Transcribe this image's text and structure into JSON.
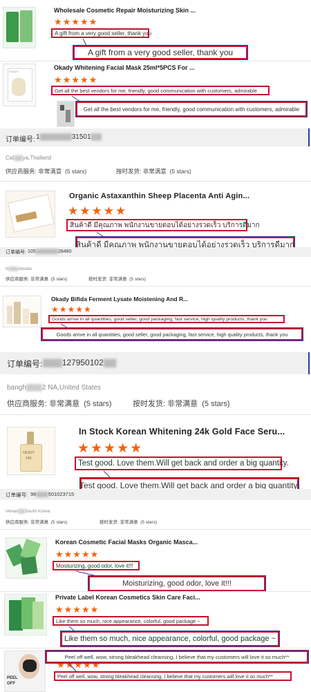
{
  "reviews": [
    {
      "title": "Wholesale Cosmetic Repair Moisturizing Skin ...",
      "stars": "★★★★★",
      "review": "A gift from a very good seller, thank you",
      "bubble": "A gift from a very good seller, thank you"
    },
    {
      "title": "Okady Whitening Facial Mask 25ml*5PCS For ...",
      "stars": "★★★★★",
      "review": "Get all the best vendors for me, friendly, good communication with customers, admirable",
      "bubble": "Get all the best vendors for me, friendly, good communication with customers, admirable"
    },
    {
      "title": "Organic Astaxanthin Sheep Placenta Anti Agin...",
      "stars": "★★★★★",
      "review": "สินค้าดี มีคุณภาพ พนักงานขายตอบได้อย่างรวดเร็ว บริการดีมาก",
      "bubble": "สินค้าดี มีคุณภาพ พนักงานขายตอบได้อย่างรวดเร็ว บริการดีมาก"
    },
    {
      "title": "Okady Bifida Ferment Lysate Moistening And R...",
      "stars": "★★★★★",
      "review": "Goods arrive in all quantities, good seller, good packaging, fast service, high quality products, thank you",
      "bubble": "Goods arrive in all quantities, good seller, good packaging, fast service, high quality products, thank you"
    },
    {
      "title": "In Stock Korean Whitening 24k Gold Face Seru...",
      "stars": "★★★★★",
      "review": "Test good. Love them.Will get back and order a big quantity.",
      "bubble": "Test good. Love them.Will get back and order a big quantity."
    },
    {
      "title": "Korean Cosmetic Facial Masks Organic Masca...",
      "stars": "★★★★★",
      "review": "Moisturizing, good odor, love it!!!",
      "bubble": "Moisturizing, good odor, love it!!!"
    },
    {
      "title": "Private Label Korean Cosmetics Skin Care Faci...",
      "stars": "★★★★★",
      "review": "Like them so much, nice appearance, colorful, good package ~",
      "bubble": "Like them so much, nice appearance, colorful, good package ~"
    },
    {
      "stars": "★★★★★",
      "review": "Peel off well, wow, strong bleakhead cleansing, I believe that my customers will love it so much**",
      "bubble": "Peel off well, wow, strong bleakhead cleansing, I believe that my customers will love it so much**"
    }
  ],
  "orders": [
    {
      "label": "订单编号:",
      "number": "1",
      "number_mid": "31501",
      "location_a": "Cat",
      "location_b": "ya,Thailand",
      "supplier_label": "供应商服务:",
      "supplier_value": "非常满意",
      "supplier_stars": "(5 stars)",
      "delivery_label": "按时发货:",
      "delivery_value": "非常满意",
      "delivery_stars": "(5 stars)"
    },
    {
      "label": "订单编号:",
      "number": "105",
      "number_tail": "28480",
      "location_a": "N",
      "location_b": "mbodia",
      "supplier_label": "供应商服务:",
      "supplier_value": "非常满意",
      "supplier_stars": "(5 stars)",
      "delivery_label": "按时发货:",
      "delivery_value": "非常满意",
      "delivery_stars": "(5 stars)"
    },
    {
      "label": "订单编号:",
      "number": "127950102",
      "location_a": "bangh",
      "location_b": "2 NA,United States",
      "supplier_label": "供应商服务:",
      "supplier_value": "非常满意",
      "supplier_stars": "(5 stars)",
      "delivery_label": "按时发货:",
      "delivery_value": "非常满意",
      "delivery_stars": "(5 stars)"
    },
    {
      "label": "订单编号:",
      "number": "98",
      "number_tail": "501023715",
      "location_a": "Venas",
      "location_b": "South Korea",
      "supplier_label": "供应商服务:",
      "supplier_value": "非常满意",
      "supplier_stars": "(5 stars)",
      "delivery_label": "按时发货:",
      "delivery_value": "非常满意",
      "delivery_stars": "(5 stars)"
    }
  ],
  "thumb_text": {
    "brand_okady": "OKADY",
    "serum_sub": "24K",
    "peel_a": "PEEL",
    "peel_b": "OFF"
  },
  "colors": {
    "star": "#f2630a",
    "highlight_border": "#c8102e",
    "bubble_outline": "#2a3fa0",
    "order_bar": "#f0f0f0"
  },
  "icons": [
    "face-mask-pack",
    "mask-box",
    "sheep-placenta-box",
    "skincare-bottles",
    "gold-serum-bottle",
    "green-face-masks",
    "peel-off-mask-model"
  ]
}
